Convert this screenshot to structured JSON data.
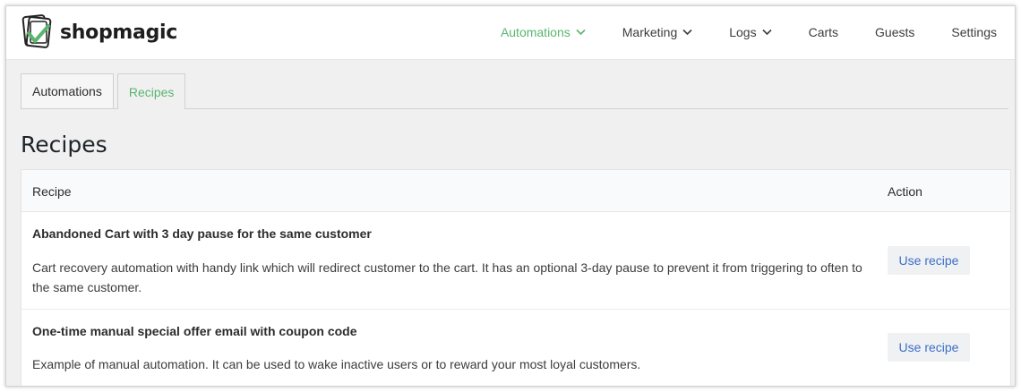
{
  "app": {
    "brand": "shopmagic",
    "accent_color": "#5ab56f",
    "link_color": "#3b6fc9"
  },
  "nav": {
    "items": [
      {
        "label": "Automations",
        "active": true,
        "dropdown": true
      },
      {
        "label": "Marketing",
        "active": false,
        "dropdown": true
      },
      {
        "label": "Logs",
        "active": false,
        "dropdown": true
      },
      {
        "label": "Carts",
        "active": false,
        "dropdown": false
      },
      {
        "label": "Guests",
        "active": false,
        "dropdown": false
      },
      {
        "label": "Settings",
        "active": false,
        "dropdown": false
      }
    ]
  },
  "tabs": [
    {
      "label": "Automations",
      "active": false
    },
    {
      "label": "Recipes",
      "active": true
    }
  ],
  "page": {
    "title": "Recipes"
  },
  "table": {
    "columns": [
      "Recipe",
      "Action"
    ],
    "rows": [
      {
        "title": "Abandoned Cart with 3 day pause for the same customer",
        "description": "Cart recovery automation with handy link which will redirect customer to the cart. It has an optional 3-day pause to prevent it from triggering to often to the same customer.",
        "action": "Use recipe"
      },
      {
        "title": "One-time manual special offer email with coupon code",
        "description": "Example of manual automation. It can be used to wake inactive users or to reward your most loyal customers.",
        "action": "Use recipe"
      }
    ]
  },
  "icons": {
    "logo": "shopmagic-logo-icon",
    "dropdown": "chevron-down-icon"
  }
}
